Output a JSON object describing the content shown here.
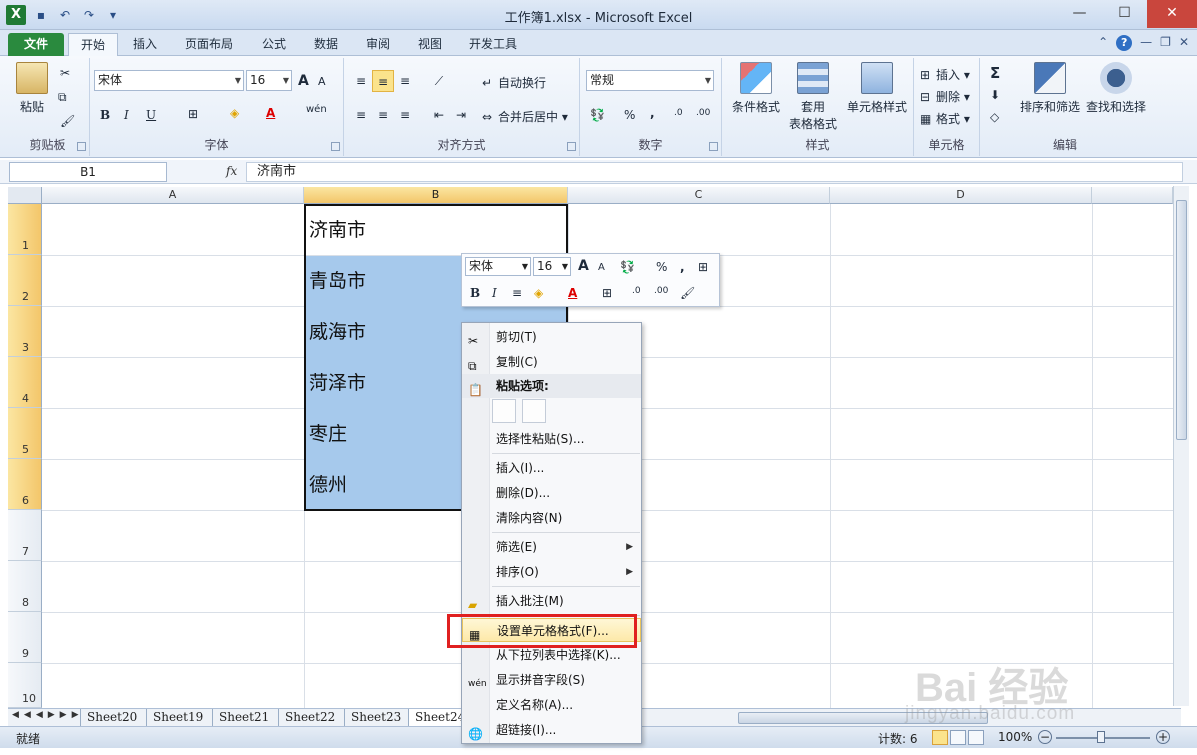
{
  "window": {
    "title": "工作簿1.xlsx - Microsoft Excel",
    "controls": {
      "minimize": "—",
      "maximize": "☐",
      "close": "✕"
    }
  },
  "ribbon_tabs": [
    "文件",
    "开始",
    "插入",
    "页面布局",
    "公式",
    "数据",
    "审阅",
    "视图",
    "开发工具"
  ],
  "ribbon": {
    "clipboard": {
      "paste": "粘贴",
      "label": "剪贴板"
    },
    "font": {
      "name": "宋体",
      "size": "16",
      "label": "字体",
      "bold": "B",
      "italic": "I",
      "underline": "U",
      "grow": "A",
      "shrink": "A",
      "font_color_letter": "A",
      "phonetic": "wén"
    },
    "alignment": {
      "wrap": "自动换行",
      "merge": "合并后居中",
      "label": "对齐方式"
    },
    "number": {
      "format": "常规",
      "percent": "%",
      "comma": ",",
      "label": "数字"
    },
    "styles": {
      "conditional": "条件格式",
      "table": "套用\n表格格式",
      "table_line1": "套用",
      "table_line2": "表格格式",
      "cell_styles": "单元格样式",
      "label": "样式"
    },
    "cells": {
      "insert": "插入",
      "delete": "删除",
      "format": "格式",
      "label": "单元格"
    },
    "editing": {
      "sum": "Σ",
      "sort": "排序和筛选",
      "find": "查找和选择",
      "label": "编辑"
    }
  },
  "formula_bar": {
    "name_box": "B1",
    "fx": "fx",
    "content": "济南市"
  },
  "columns": [
    "A",
    "B",
    "C",
    "D"
  ],
  "rows": [
    "1",
    "2",
    "3",
    "4",
    "5",
    "6",
    "7",
    "8",
    "9",
    "10"
  ],
  "cells_b": [
    "济南市",
    "青岛市",
    "威海市",
    "菏泽市",
    "枣庄",
    "德州"
  ],
  "mini_toolbar": {
    "font": "宋体",
    "size": "16",
    "percent": "%",
    "comma": ",",
    "bold": "B",
    "italic": "I",
    "font_color_letter": "A"
  },
  "context_menu": {
    "cut": "剪切(T)",
    "copy": "复制(C)",
    "paste_options": "粘贴选项:",
    "paste_special": "选择性粘贴(S)...",
    "insert": "插入(I)...",
    "delete": "删除(D)...",
    "clear": "清除内容(N)",
    "filter": "筛选(E)",
    "sort": "排序(O)",
    "comment": "插入批注(M)",
    "format_cells": "设置单元格格式(F)...",
    "pick_list": "从下拉列表中选择(K)...",
    "phonetic": "显示拼音字段(S)",
    "define_name": "定义名称(A)...",
    "hyperlink": "超链接(I)..."
  },
  "sheet_tabs": [
    "Sheet20",
    "Sheet19",
    "Sheet21",
    "Sheet22",
    "Sheet23",
    "Sheet24"
  ],
  "status_bar": {
    "ready": "就绪",
    "count": "计数: 6",
    "zoom": "100%"
  },
  "watermark": {
    "text": "Bai 经验",
    "url": "jingyan.baidu.com"
  },
  "colors": {
    "selection": "#a6c9ec",
    "file_tab": "#2a8a3e",
    "highlight_border": "#e02020"
  }
}
